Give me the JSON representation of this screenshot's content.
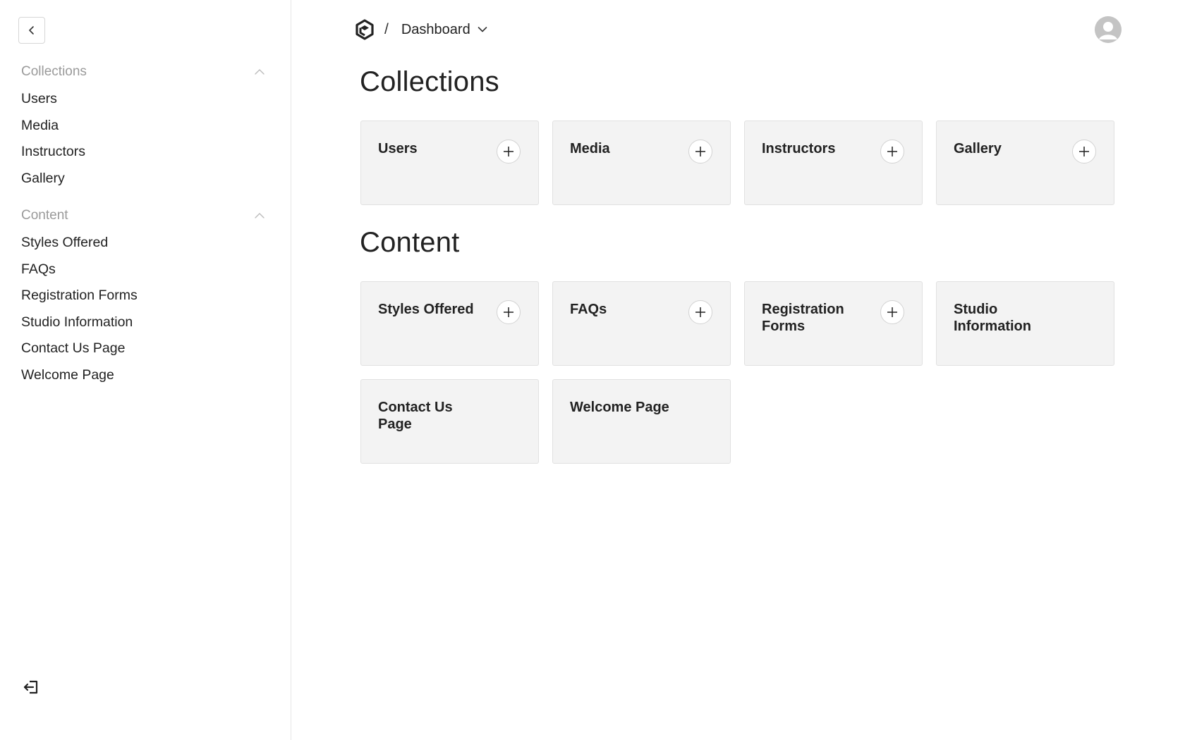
{
  "sidebar": {
    "groups": [
      {
        "label": "Collections",
        "items": [
          "Users",
          "Media",
          "Instructors",
          "Gallery"
        ]
      },
      {
        "label": "Content",
        "items": [
          "Styles Offered",
          "FAQs",
          "Registration Forms",
          "Studio Information",
          "Contact Us Page",
          "Welcome Page"
        ]
      }
    ]
  },
  "header": {
    "separator": "/",
    "current_view": "Dashboard"
  },
  "sections": {
    "collections": {
      "title": "Collections",
      "cards": [
        "Users",
        "Media",
        "Instructors",
        "Gallery"
      ]
    },
    "content": {
      "title": "Content",
      "cards": [
        "Styles Offered",
        "FAQs",
        "Registration Forms",
        "Studio Information",
        "Contact Us Page",
        "Welcome Page"
      ]
    }
  },
  "icons": {
    "collapse": "chevron-left-icon",
    "group_toggle": "chevron-up-icon",
    "logo": "logo-icon",
    "dropdown": "chevron-down-icon",
    "add": "plus-icon",
    "avatar": "user-avatar-icon",
    "logout": "logout-icon"
  }
}
